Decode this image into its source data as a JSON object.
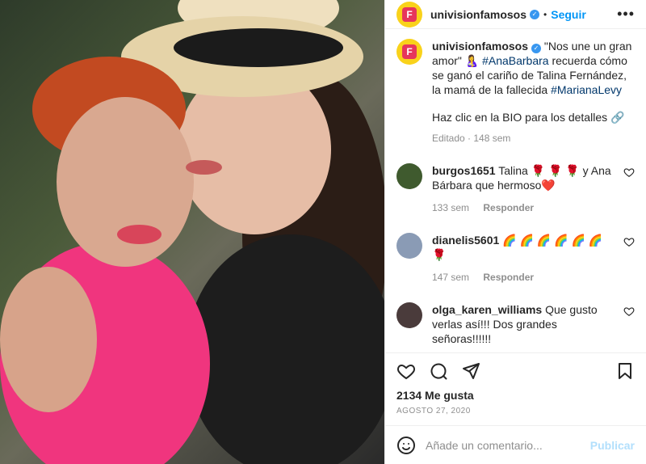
{
  "header": {
    "username": "univisionfamosos",
    "follow_label": "Seguir",
    "dot": "•"
  },
  "caption": {
    "username": "univisionfamosos",
    "text_part1": "\"Nos une un gran amor\" 🤱",
    "hashtag1": "#AnaBarbara",
    "text_part2": " recuerda cómo se ganó el cariño de Talina Fernández, la mamá de la fallecida ",
    "hashtag2": "#MarianaLevy",
    "line2": "Haz clic en la BIO para los detalles 🔗",
    "meta": "Editado · 148 sem"
  },
  "comments": [
    {
      "user": "burgos1651",
      "text": "Talina 🌹 🌹 🌹 y Ana Bárbara que hermoso❤️",
      "time": "133 sem",
      "reply": "Responder"
    },
    {
      "user": "dianelis5601",
      "text": "🌈 🌈 🌈 🌈 🌈 🌈 🌹",
      "time": "147 sem",
      "reply": "Responder"
    },
    {
      "user": "olga_karen_williams",
      "text": "Que gusto verlas así!!! Dos grandes señoras!!!!!!",
      "time": "",
      "reply": ""
    }
  ],
  "actions": {
    "likes": "2134 Me gusta",
    "date": "AGOSTO 27, 2020"
  },
  "add_comment": {
    "placeholder": "Añade un comentario...",
    "publish": "Publicar"
  },
  "colors": {
    "accent": "#0095f6",
    "brand_yellow": "#f9d21b",
    "brand_pink": "#e6365c"
  }
}
